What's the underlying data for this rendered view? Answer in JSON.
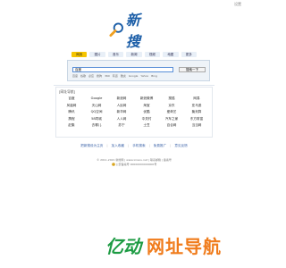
{
  "header": {
    "corner_link": "设置",
    "logo_text": "新搜"
  },
  "search": {
    "tabs": [
      {
        "label": "网页",
        "active": true
      },
      {
        "label": "图片",
        "active": false
      },
      {
        "label": "音乐",
        "active": false
      },
      {
        "label": "新闻",
        "active": false
      },
      {
        "label": "视频",
        "active": false
      },
      {
        "label": "地图",
        "active": false
      },
      {
        "label": "更多",
        "active": false
      }
    ],
    "query": "百度",
    "button_label": "搜索一下",
    "engines": [
      "百度",
      "谷歌",
      "必应",
      "搜狗",
      "360",
      "有道",
      "雅虎",
      "Google",
      "Yahoo",
      "Bing"
    ]
  },
  "nav": {
    "heading": "[网址导航]",
    "items": [
      "百度",
      "Google",
      "新浪网",
      "新浪微博",
      "搜狐",
      "网易",
      "凤凰网",
      "天山网",
      "人民网",
      "淘宝",
      "京东",
      "亚马逊",
      "腾讯",
      "QQ空间",
      "新华网",
      "优酷",
      "爱奇艺",
      "聚划算",
      "携程",
      "58同城",
      "人人网",
      "中关村",
      "汽车之家",
      "东方财富",
      "赶集",
      "去哪儿",
      "苏宁",
      "土豆",
      "百合网",
      "当当网"
    ]
  },
  "footer": {
    "links": [
      "把新搜设为主页",
      "加入收藏",
      "手机搜索",
      "免费推广",
      "意见反馈"
    ],
    "copyright": "© 2011-2021 新搜网 | www.xinsou.net | 联系邮箱 | 备案号",
    "beian": "公安备案号 00000000000000号"
  },
  "watermark": {
    "logo": "亿动",
    "text": "网址导航"
  },
  "colors": {
    "logo_blue": "#1d5fa8",
    "tab_active": "#f5c400",
    "watermark_green": "#1d9b43",
    "watermark_orange": "#f07c1c",
    "link_blue": "#3a62a8"
  }
}
